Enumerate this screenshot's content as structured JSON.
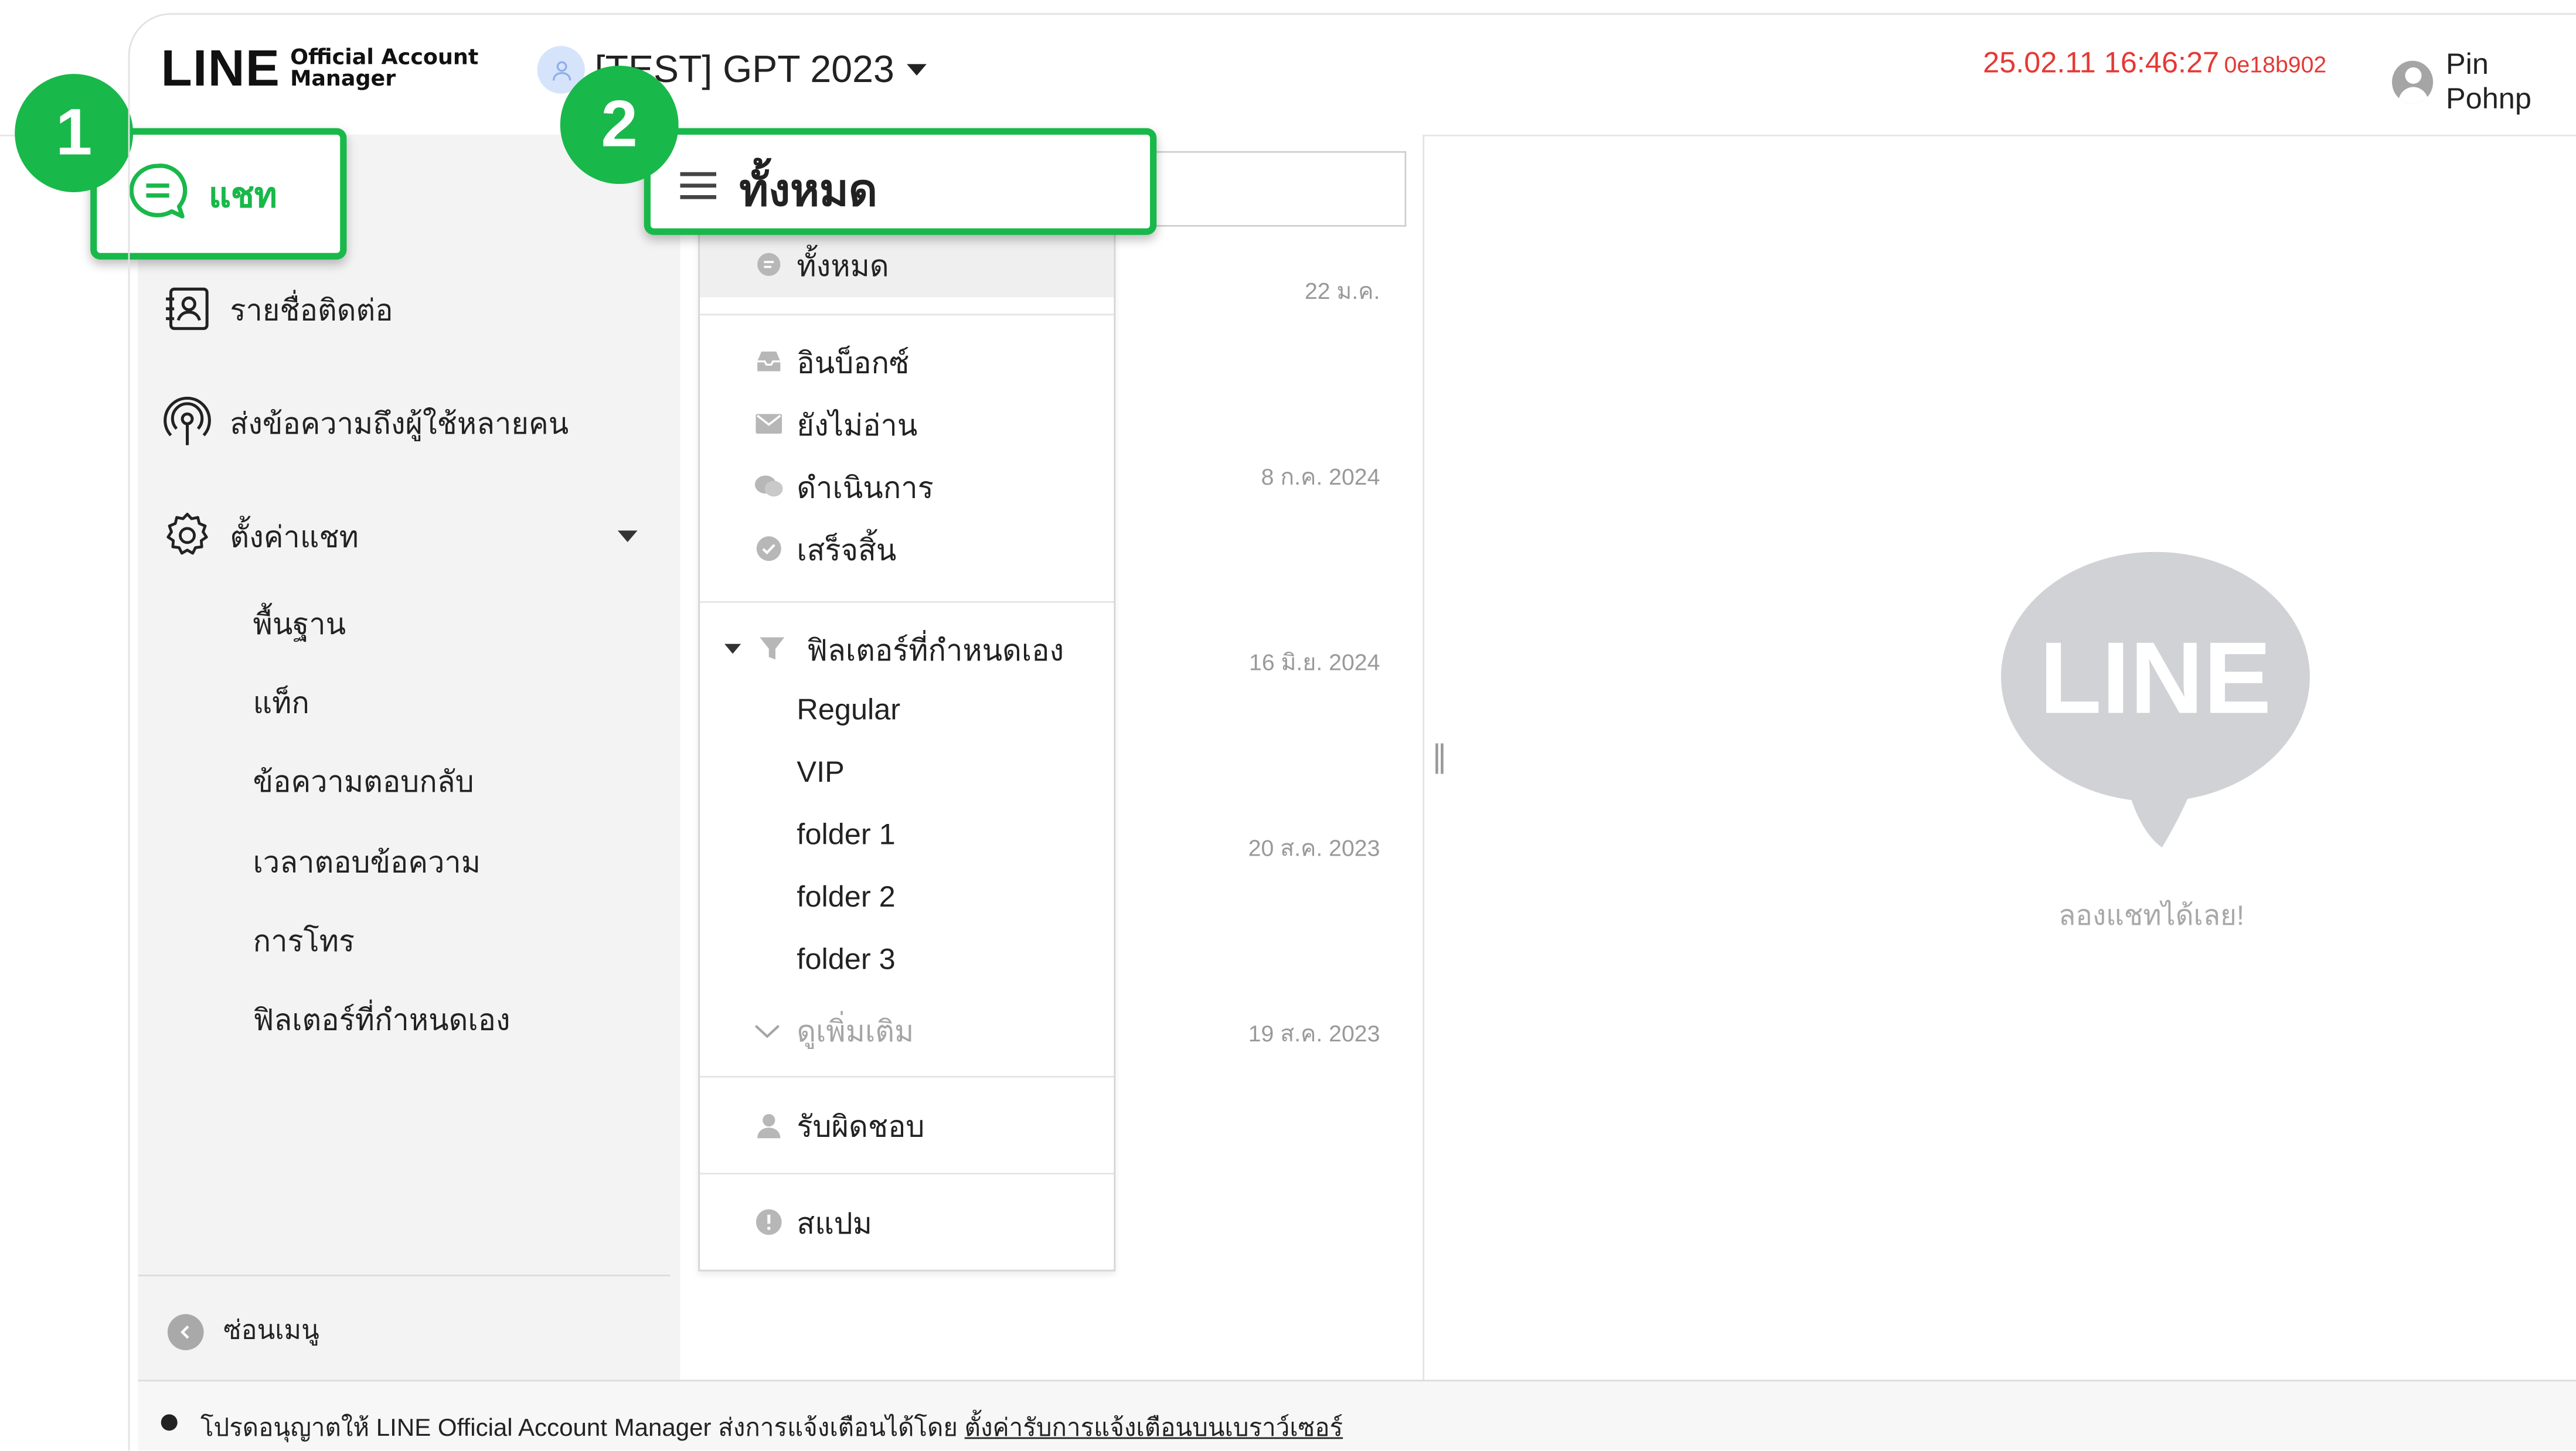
{
  "header": {
    "logo_word": "LINE",
    "logo_sub_1": "Official Account",
    "logo_sub_2": "Manager",
    "account_name": "[TEST] GPT 2023",
    "timestamp": "25.02.11 16:46:27",
    "session_id": "0e18b902",
    "user_name": "Pin Pohnp"
  },
  "sidebar": {
    "chat": "แชท",
    "contacts": "รายชื่อติดต่อ",
    "broadcast": "ส่งข้อความถึงผู้ใช้หลายคน",
    "settings": "ตั้งค่าแชท",
    "settings_children": [
      "พื้นฐาน",
      "แท็ก",
      "ข้อความตอบกลับ",
      "เวลาตอบข้อความ",
      "การโทร",
      "ฟิลเตอร์ที่กำหนดเอง"
    ],
    "hide_menu": "ซ่อนเมนู"
  },
  "filter": {
    "selected": "ทั้งหมด"
  },
  "dropdown": {
    "all": "ทั้งหมด",
    "inbox": "อินบ็อกซ์",
    "unread": "ยังไม่อ่าน",
    "in_progress": "ดำเนินการ",
    "done": "เสร็จสิ้น",
    "custom_filters": "ฟิลเตอร์ที่กำหนดเอง",
    "custom_list": [
      "Regular",
      "VIP",
      "folder 1",
      "folder 2",
      "folder 3"
    ],
    "see_more": "ดูเพิ่มเติม",
    "assigned": "รับผิดชอบ",
    "spam": "สแปม"
  },
  "chat_dates": [
    "22 ม.ค.",
    "8 ก.ค. 2024",
    "16 มิ.ย. 2024",
    "20 ส.ค. 2023",
    "19 ส.ค. 2023"
  ],
  "empty_state": {
    "logo_text": "LINE",
    "message": "ลองแชทได้เลย!"
  },
  "footer": {
    "text": "โปรดอนุญาตให้ LINE Official Account Manager ส่งการแจ้งเตือนได้โดย",
    "link": "ตั้งค่ารับการแจ้งเตือนบนเบราว์เซอร์"
  },
  "badges": [
    "1",
    "2"
  ],
  "colors": {
    "brand_green": "#19b84a",
    "timestamp_red": "#e53935",
    "sidebar_bg": "#f3f3f4"
  }
}
